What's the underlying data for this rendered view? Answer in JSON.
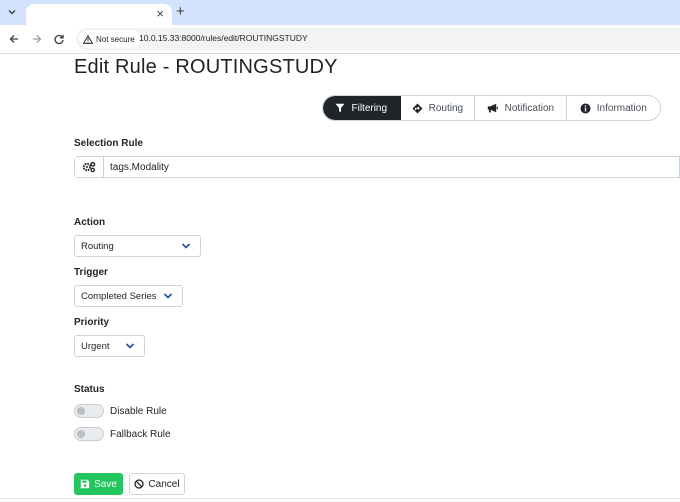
{
  "browser": {
    "tab_close": "×",
    "new_tab": "+",
    "security_chip": "Not secure",
    "url": "10.0.15.33:8000/rules/edit/ROUTINGSTUDY"
  },
  "page": {
    "title": "Edit Rule - ROUTINGSTUDY"
  },
  "tabs": [
    {
      "label": "Filtering",
      "icon": "filter-icon",
      "active": true
    },
    {
      "label": "Routing",
      "icon": "diamond-arrow-icon",
      "active": false
    },
    {
      "label": "Notification",
      "icon": "megaphone-icon",
      "active": false
    },
    {
      "label": "Information",
      "icon": "info-icon",
      "active": false
    }
  ],
  "selection_rule": {
    "label": "Selection Rule",
    "value": "tags.Modality",
    "icon": "gears-icon"
  },
  "action": {
    "label": "Action",
    "selected": "Routing"
  },
  "trigger": {
    "label": "Trigger",
    "selected": "Completed Series"
  },
  "priority": {
    "label": "Priority",
    "selected": "Urgent"
  },
  "status": {
    "label": "Status",
    "disable_rule": {
      "label": "Disable Rule",
      "on": false
    },
    "fallback_rule": {
      "label": "Fallback Rule",
      "on": false
    }
  },
  "buttons": {
    "save": "Save",
    "cancel": "Cancel"
  },
  "colors": {
    "active_tab": "#212529",
    "save_button": "#22c55e",
    "chrome_tabstrip": "#d3e3fd"
  }
}
